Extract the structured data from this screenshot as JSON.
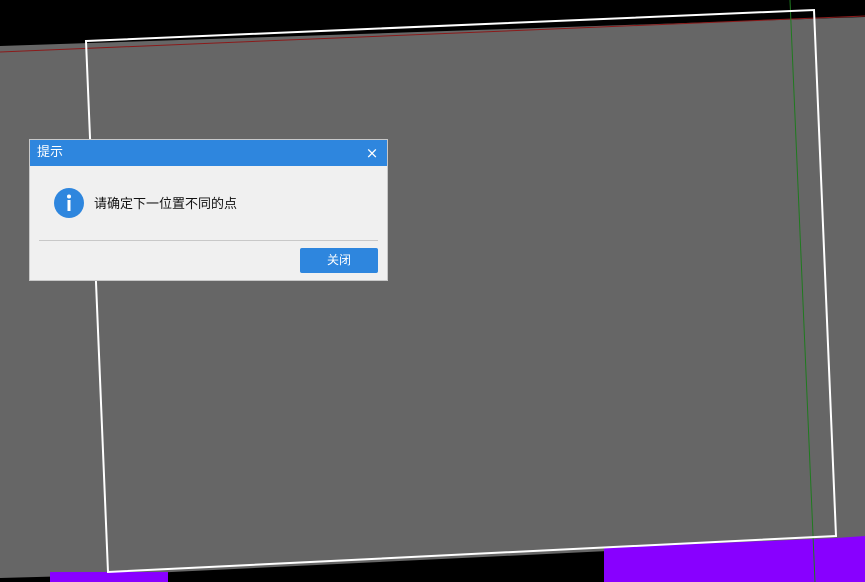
{
  "colors": {
    "background": "#000000",
    "viewport_fill": "#666666",
    "viewport_border": "#ffffff",
    "x_axis": "#8b1a1a",
    "y_axis": "#1f7a1f",
    "highlight": "#8800ff",
    "dialog_accent": "#2e86de",
    "dialog_body": "#f0f0f0"
  },
  "dialog": {
    "title": "提示",
    "close_glyph": "×",
    "icon": "info-icon",
    "message": "请确定下一位置不同的点",
    "close_button_label": "关闭"
  }
}
